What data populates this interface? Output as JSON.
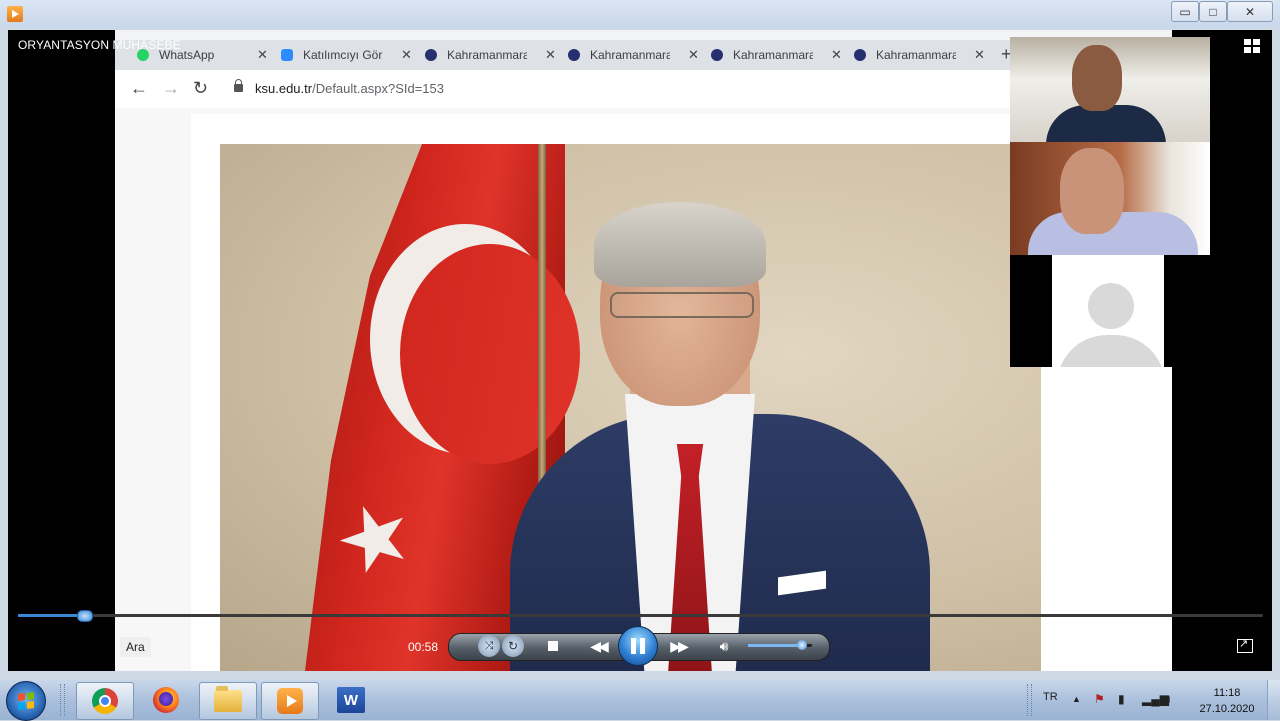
{
  "window": {
    "icon": "media-player-icon",
    "controls": {
      "minimize": "▭",
      "maximize": "□",
      "close": "✕"
    }
  },
  "player": {
    "title": "ORYANTASYON MUHASEBE",
    "search_label": "Ara",
    "current_time": "00:58",
    "seek_progress": 0.053,
    "volume_level": 0.85,
    "accent_color": "#3b87d6"
  },
  "browser": {
    "tabs": [
      {
        "label": "WhatsApp",
        "icon": "whatsapp-icon",
        "color": "#25d366"
      },
      {
        "label": "Katılımcıyı Görü",
        "icon": "zoom-icon",
        "color": "#2d8cff"
      },
      {
        "label": "Kahramanmara",
        "icon": "ksu-logo-icon",
        "color": "#27306e"
      },
      {
        "label": "Kahramanmara",
        "icon": "ksu-logo-icon",
        "color": "#27306e"
      },
      {
        "label": "Kahramanmara",
        "icon": "ksu-logo-icon",
        "color": "#27306e"
      },
      {
        "label": "Kahramanmara",
        "icon": "ksu-logo-icon",
        "color": "#27306e"
      }
    ],
    "tab_close": "✕",
    "new_tab": "+",
    "url_host": "ksu.edu.tr",
    "url_path": "/Default.aspx?SId=153"
  },
  "taskbar": {
    "apps": [
      {
        "name": "chrome",
        "icon": "chrome-icon"
      },
      {
        "name": "firefox",
        "icon": "firefox-icon"
      },
      {
        "name": "file-explorer",
        "icon": "folder-icon"
      },
      {
        "name": "windows-media-player",
        "icon": "media-player-icon"
      },
      {
        "name": "word",
        "icon": "word-icon",
        "letter": "W"
      }
    ],
    "language": "TR",
    "time": "11:18",
    "date": "27.10.2020"
  }
}
